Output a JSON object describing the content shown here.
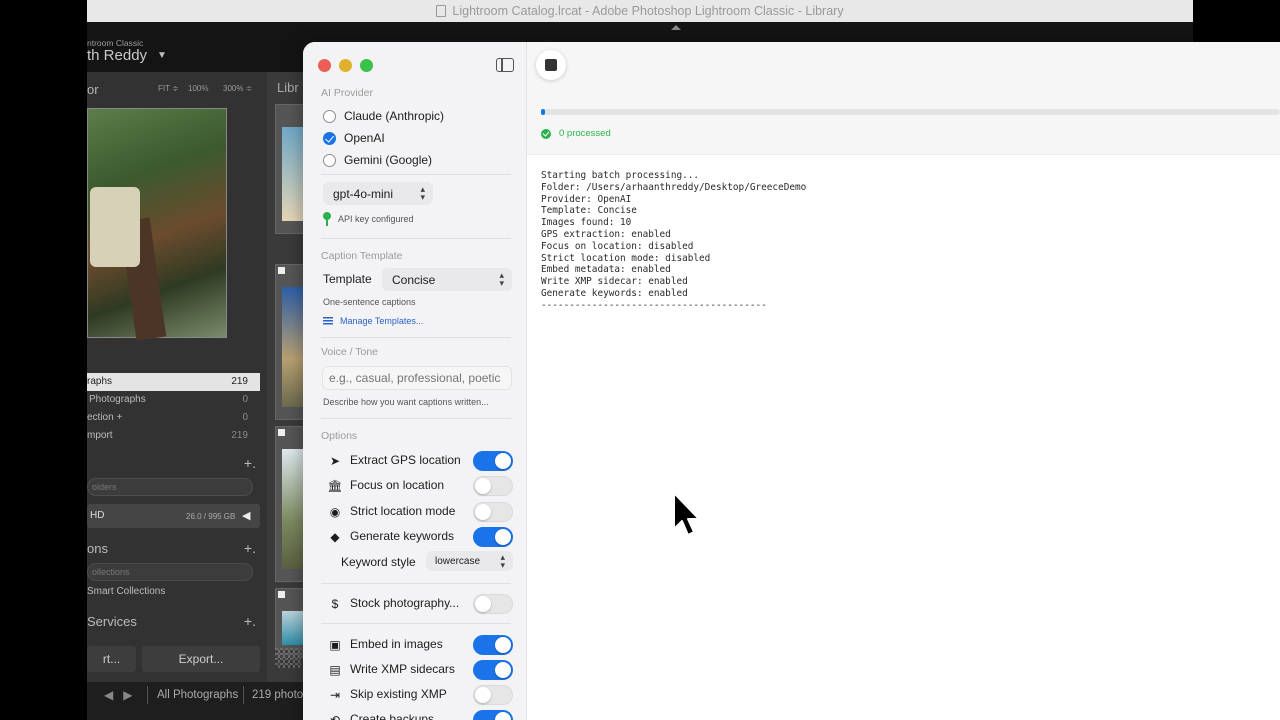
{
  "window_title": "Lightroom Catalog.lrcat - Adobe Photoshop Lightroom Classic - Library",
  "lightroom": {
    "brand_small": "ntroom Classic",
    "brand_user": "th Reddy",
    "navigator": {
      "label": "or",
      "fit": "FIT ≑",
      "zoom100": "100%",
      "zoom300": "300% ≑"
    },
    "library_label": "Libr",
    "catalog": [
      {
        "label": "raphs",
        "count": "219",
        "selected": true
      },
      {
        "label": "Photographs",
        "count": "0"
      },
      {
        "label": "ection  +",
        "count": "0"
      },
      {
        "label": "mport",
        "count": "219"
      }
    ],
    "folders_filter": "olders",
    "drive": {
      "name": "HD",
      "size": "26.0 / 995 GB"
    },
    "collections_head": "ons",
    "collections_filter": "ollections",
    "smart_collections": "Smart Collections",
    "services_head": "Services",
    "import_button": "rt...",
    "export_button": "Export...",
    "bottom": {
      "source": "All Photographs",
      "count": "219 photo"
    }
  },
  "app": {
    "provider_section": "AI Provider",
    "providers": [
      {
        "label": "Claude (Anthropic)",
        "selected": false
      },
      {
        "label": "OpenAI",
        "selected": true
      },
      {
        "label": "Gemini (Google)",
        "selected": false
      }
    ],
    "model": "gpt-4o-mini",
    "api_status": "API key configured",
    "template_section": "Caption Template",
    "template_label": "Template",
    "template_value": "Concise",
    "template_desc": "One-sentence captions",
    "manage_templates": "Manage Templates...",
    "tone_section": "Voice / Tone",
    "tone_placeholder": "e.g., casual, professional, poetic",
    "tone_desc": "Describe how you want captions written...",
    "options_section": "Options",
    "options": [
      {
        "label": "Extract GPS location",
        "icon": "location-arrow-icon",
        "on": true
      },
      {
        "label": "Focus on location",
        "icon": "landmark-icon",
        "on": false
      },
      {
        "label": "Strict location mode",
        "icon": "eye-slash-icon",
        "on": false
      },
      {
        "label": "Generate keywords",
        "icon": "tag-icon",
        "on": true
      }
    ],
    "keyword_style_label": "Keyword style",
    "keyword_style_value": "lowercase",
    "stock_option": {
      "label": "Stock photography...",
      "icon": "dollar-circle-icon",
      "on": false
    },
    "output_options": [
      {
        "label": "Embed in images",
        "icon": "image-plus-icon",
        "on": true
      },
      {
        "label": "Write XMP sidecars",
        "icon": "document-icon",
        "on": true
      },
      {
        "label": "Skip existing XMP",
        "icon": "skip-arrow-icon",
        "on": false
      },
      {
        "label": "Create backups",
        "icon": "backup-icon",
        "on": true
      }
    ],
    "progress_fraction": 0.005,
    "status": "0 processed",
    "log": "Starting batch processing...\nFolder: /Users/arhaanthreddy/Desktop/GreeceDemo\nProvider: OpenAI\nTemplate: Concise\nImages found: 10\nGPS extraction: enabled\nFocus on location: disabled\nStrict location mode: disabled\nEmbed metadata: enabled\nWrite XMP sidecar: enabled\nGenerate keywords: enabled\n----------------------------------------",
    "colors": {
      "accent": "#1a73e8",
      "success": "#2bb24c",
      "close": "#ec5f57",
      "minimize": "#dfb12f",
      "maximize": "#39c24b"
    }
  }
}
